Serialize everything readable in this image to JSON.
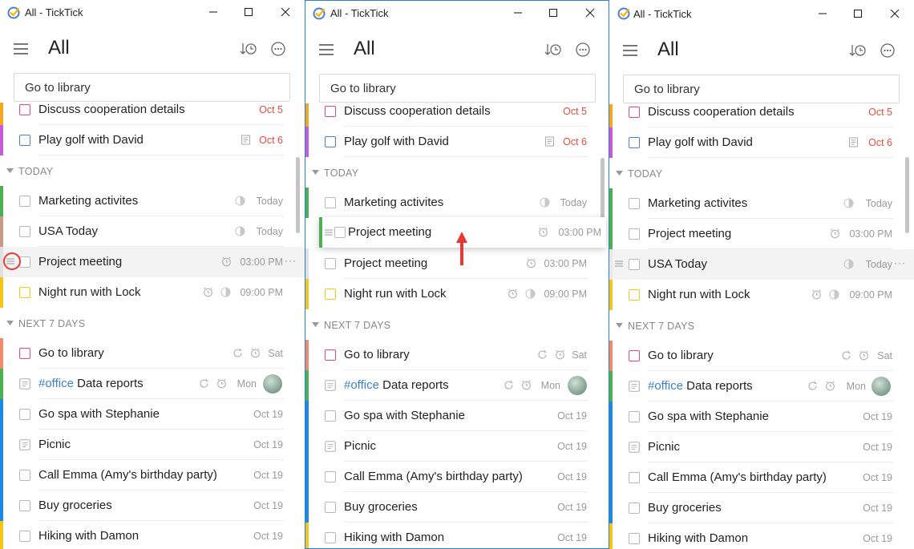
{
  "window": {
    "title": "All - TickTick"
  },
  "header": {
    "title": "All"
  },
  "search": {
    "value": "Go to library"
  },
  "colors": {
    "accent": "#2a7fd4",
    "red": "#e74c3c",
    "green": "#4caf50",
    "purple": "#c45cd8",
    "blue": "#1e88e5",
    "yellow": "#f5c518",
    "salmon": "#f08a6a",
    "pink": "#e04a7e"
  },
  "tasks": {
    "cooperation": {
      "title": "Discuss cooperation details",
      "date": "Oct 5"
    },
    "golf": {
      "title": "Play golf with David",
      "date": "Oct 6"
    },
    "marketing": {
      "title": "Marketing activites",
      "date": "Today"
    },
    "usa": {
      "title": "USA Today",
      "date": "Today"
    },
    "project": {
      "title": "Project meeting",
      "date": "03:00 PM"
    },
    "nightrun": {
      "title": "Night run with Lock",
      "date": "09:00 PM"
    },
    "library": {
      "title": "Go to library",
      "date": "Sat"
    },
    "reports": {
      "tag": "#office",
      "title": " Data reports",
      "date": "Mon"
    },
    "spa": {
      "title": "Go spa with Stephanie",
      "date": "Oct 19"
    },
    "picnic": {
      "title": "Picnic",
      "date": "Oct 19"
    },
    "emma": {
      "title": "Call Emma (Amy's birthday party)",
      "date": "Oct 19"
    },
    "groceries": {
      "title": "Buy groceries",
      "date": "Oct 19"
    },
    "hiking": {
      "title": "Hiking with Damon",
      "date": "Oct 19"
    }
  },
  "sections": {
    "today": "TODAY",
    "next7": "NEXT 7 DAYS"
  },
  "more_dots": "···"
}
